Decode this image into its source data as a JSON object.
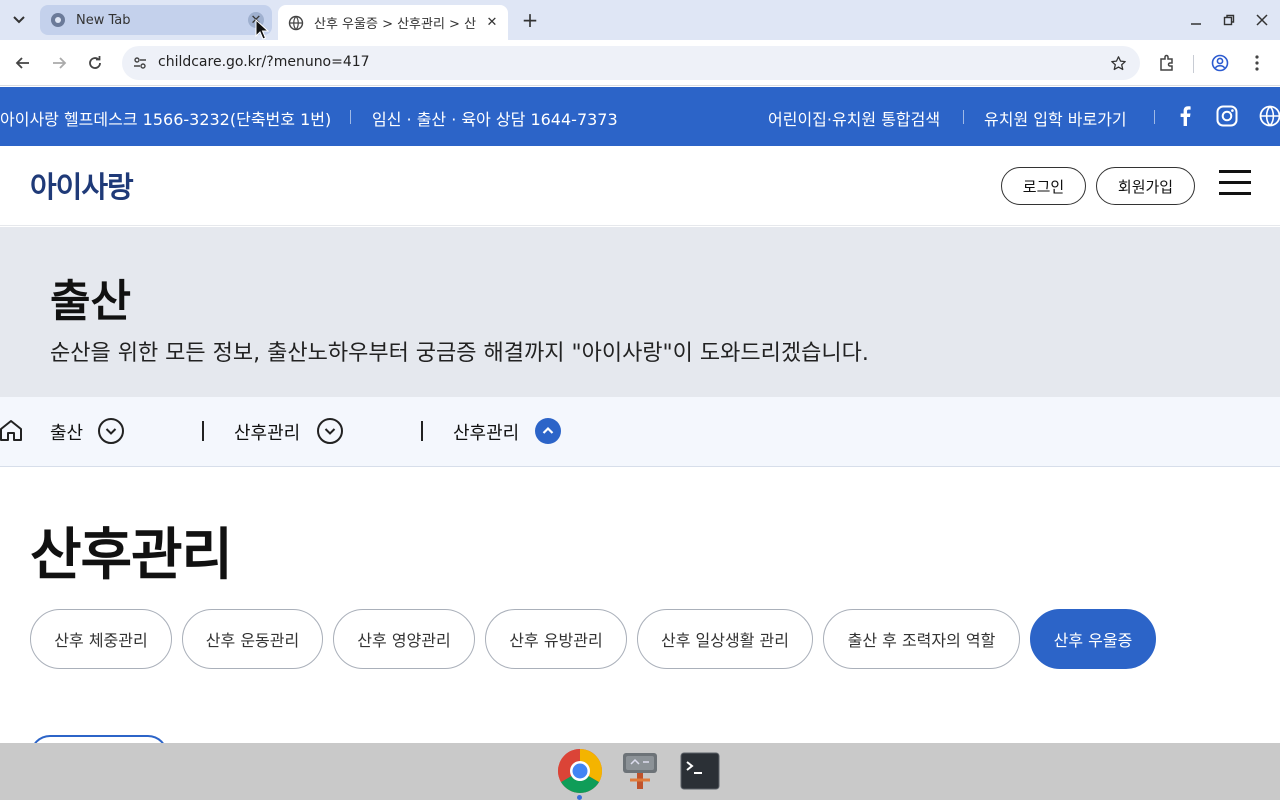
{
  "browser": {
    "tabs": [
      {
        "title": "New Tab",
        "active": false
      },
      {
        "title": "산후 우울증 > 산후관리 > 산",
        "active": true
      }
    ],
    "url": "childcare.go.kr/?menuno=417"
  },
  "topbar": {
    "helpdesk": "아이사랑 헬프데스크 1566-3232(단축번호 1번)",
    "consult": "임신 · 출산 · 육아 상담 1644-7373",
    "search_link": "어린이집·유치원 통합검색",
    "kinder_link": "유치원 입학 바로가기"
  },
  "header": {
    "logo": "아이사랑",
    "login": "로그인",
    "signup": "회원가입"
  },
  "hero": {
    "title": "출산",
    "subtitle": "순산을 위한 모든 정보, 출산노하우부터 궁금증 해결까지 \"아이사랑\"이 도와드리겠습니다."
  },
  "breadcrumb": [
    "출산",
    "산후관리",
    "산후관리"
  ],
  "main": {
    "title": "산후관리",
    "chips": [
      {
        "label": "산후 체중관리",
        "active": false
      },
      {
        "label": "산후 운동관리",
        "active": false
      },
      {
        "label": "산후 영양관리",
        "active": false
      },
      {
        "label": "산후 유방관리",
        "active": false
      },
      {
        "label": "산후 일상생활 관리",
        "active": false
      },
      {
        "label": "출산 후 조력자의 역할",
        "active": false
      },
      {
        "label": "산후 우울증",
        "active": true
      }
    ]
  },
  "colors": {
    "brand": "#2c64c8",
    "logo": "#1f3a78",
    "hero_bg": "#e5e8ee"
  }
}
